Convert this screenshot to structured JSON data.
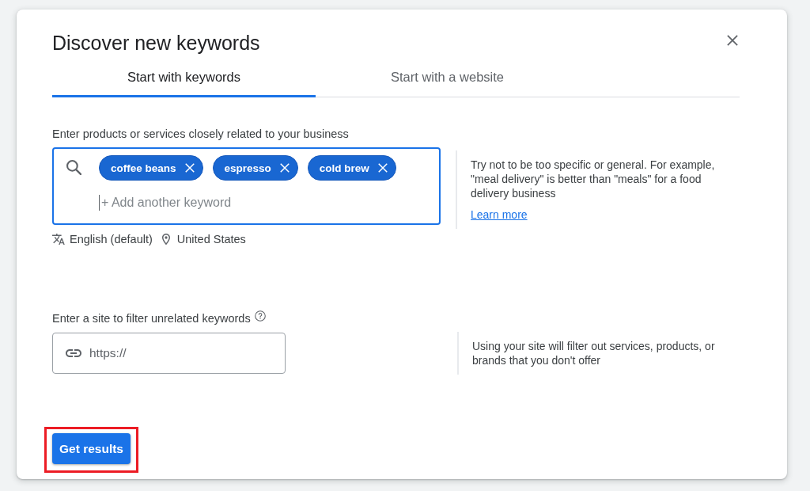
{
  "dialog": {
    "title": "Discover new keywords"
  },
  "tabs": [
    {
      "label": "Start with keywords",
      "selected": true
    },
    {
      "label": "Start with a website",
      "selected": false
    }
  ],
  "keywords_section": {
    "label": "Enter products or services closely related to your business",
    "keyword_input": {
      "focused": true,
      "chips": [
        "coffee beans",
        "espresso",
        "cold brew"
      ],
      "placeholder": "+ Add another keyword"
    },
    "language": "English (default)",
    "location": "United States",
    "hint": {
      "text": "Try not to be too specific or general. For example, \"meal delivery\" is better than \"meals\" for a food delivery business",
      "link": "Learn more"
    }
  },
  "site_section": {
    "label": "Enter a site to filter unrelated keywords",
    "url_input": {
      "placeholder": "https://"
    },
    "hint": {
      "text": "Using your site will filter out services, products, or brands that you don't offer"
    }
  },
  "get_results_button": {
    "label": "Get results",
    "highlighted": true
  }
}
